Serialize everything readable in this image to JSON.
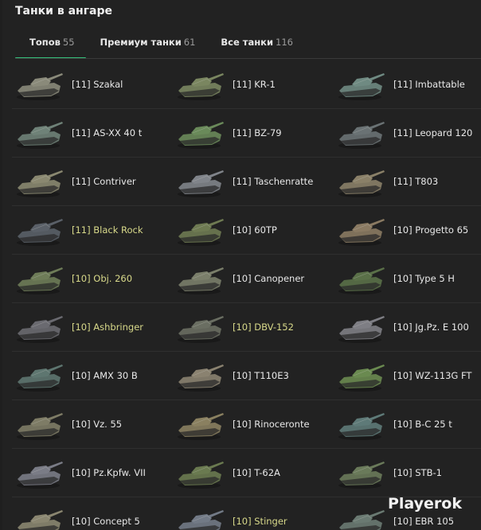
{
  "header": {
    "title": "Танки в ангаре"
  },
  "tabs": [
    {
      "label": "Топов",
      "count": "55"
    },
    {
      "label": "Премиум танки",
      "count": "61"
    },
    {
      "label": "Все танки",
      "count": "116"
    }
  ],
  "colors": {
    "accent": "#35c07a",
    "premium_text": "#d8d98a",
    "background": "#222222"
  },
  "tanks": [
    {
      "name": "[11] Szakal",
      "premium": false,
      "color": "#8a8a7a"
    },
    {
      "name": "[11] KR-1",
      "premium": false,
      "color": "#7a8660"
    },
    {
      "name": "[11] Imbattable",
      "premium": false,
      "color": "#6f8a82"
    },
    {
      "name": "[11] AS-XX 40 t",
      "premium": false,
      "color": "#6f8278"
    },
    {
      "name": "[11] BZ-79",
      "premium": false,
      "color": "#6a8a5a"
    },
    {
      "name": "[11] Leopard 120",
      "premium": false,
      "color": "#6a7274"
    },
    {
      "name": "[11] Contriver",
      "premium": false,
      "color": "#8a8870"
    },
    {
      "name": "[11] Taschenratte",
      "premium": false,
      "color": "#80848a"
    },
    {
      "name": "[11] T803",
      "premium": false,
      "color": "#8a8068"
    },
    {
      "name": "[11] Black Rock",
      "premium": true,
      "color": "#5a6068"
    },
    {
      "name": "[10] 60TP",
      "premium": false,
      "color": "#6e7a52"
    },
    {
      "name": "[10] Progetto 65",
      "premium": false,
      "color": "#8a7a62"
    },
    {
      "name": "[10] Obj. 260",
      "premium": true,
      "color": "#6e7c58"
    },
    {
      "name": "[10] Canopener",
      "premium": false,
      "color": "#7a7e6a"
    },
    {
      "name": "[10] Type 5 H",
      "premium": false,
      "color": "#5a7048"
    },
    {
      "name": "[10] Ashbringer",
      "premium": true,
      "color": "#6a6a70"
    },
    {
      "name": "[10] DBV-152",
      "premium": true,
      "color": "#6a6e62"
    },
    {
      "name": "[10] Jg.Pz. E 100",
      "premium": false,
      "color": "#7e7e84"
    },
    {
      "name": "[10] AMX 30 B",
      "premium": false,
      "color": "#5e7670"
    },
    {
      "name": "[10] T110E3",
      "premium": false,
      "color": "#8a8270"
    },
    {
      "name": "[10] WZ-113G FT",
      "premium": false,
      "color": "#6a8a50"
    },
    {
      "name": "[10] Vz. 55",
      "premium": false,
      "color": "#7e7c66"
    },
    {
      "name": "[10] Rinoceronte",
      "premium": false,
      "color": "#8a8060"
    },
    {
      "name": "[10] B-C 25 t",
      "premium": false,
      "color": "#5e7a78"
    },
    {
      "name": "[10] Pz.Kpfw. VII",
      "premium": false,
      "color": "#7a7c86"
    },
    {
      "name": "[10] T-62A",
      "premium": false,
      "color": "#6a7a50"
    },
    {
      "name": "[10] STB-1",
      "premium": false,
      "color": "#6a7a5a"
    },
    {
      "name": "[10] Concept 5",
      "premium": false,
      "color": "#8a8670"
    },
    {
      "name": "[10] Stinger",
      "premium": true,
      "color": "#727a86"
    },
    {
      "name": "[10] EBR 105",
      "premium": false,
      "color": "#6a7a72"
    }
  ],
  "watermark": {
    "text": "Playerok"
  }
}
